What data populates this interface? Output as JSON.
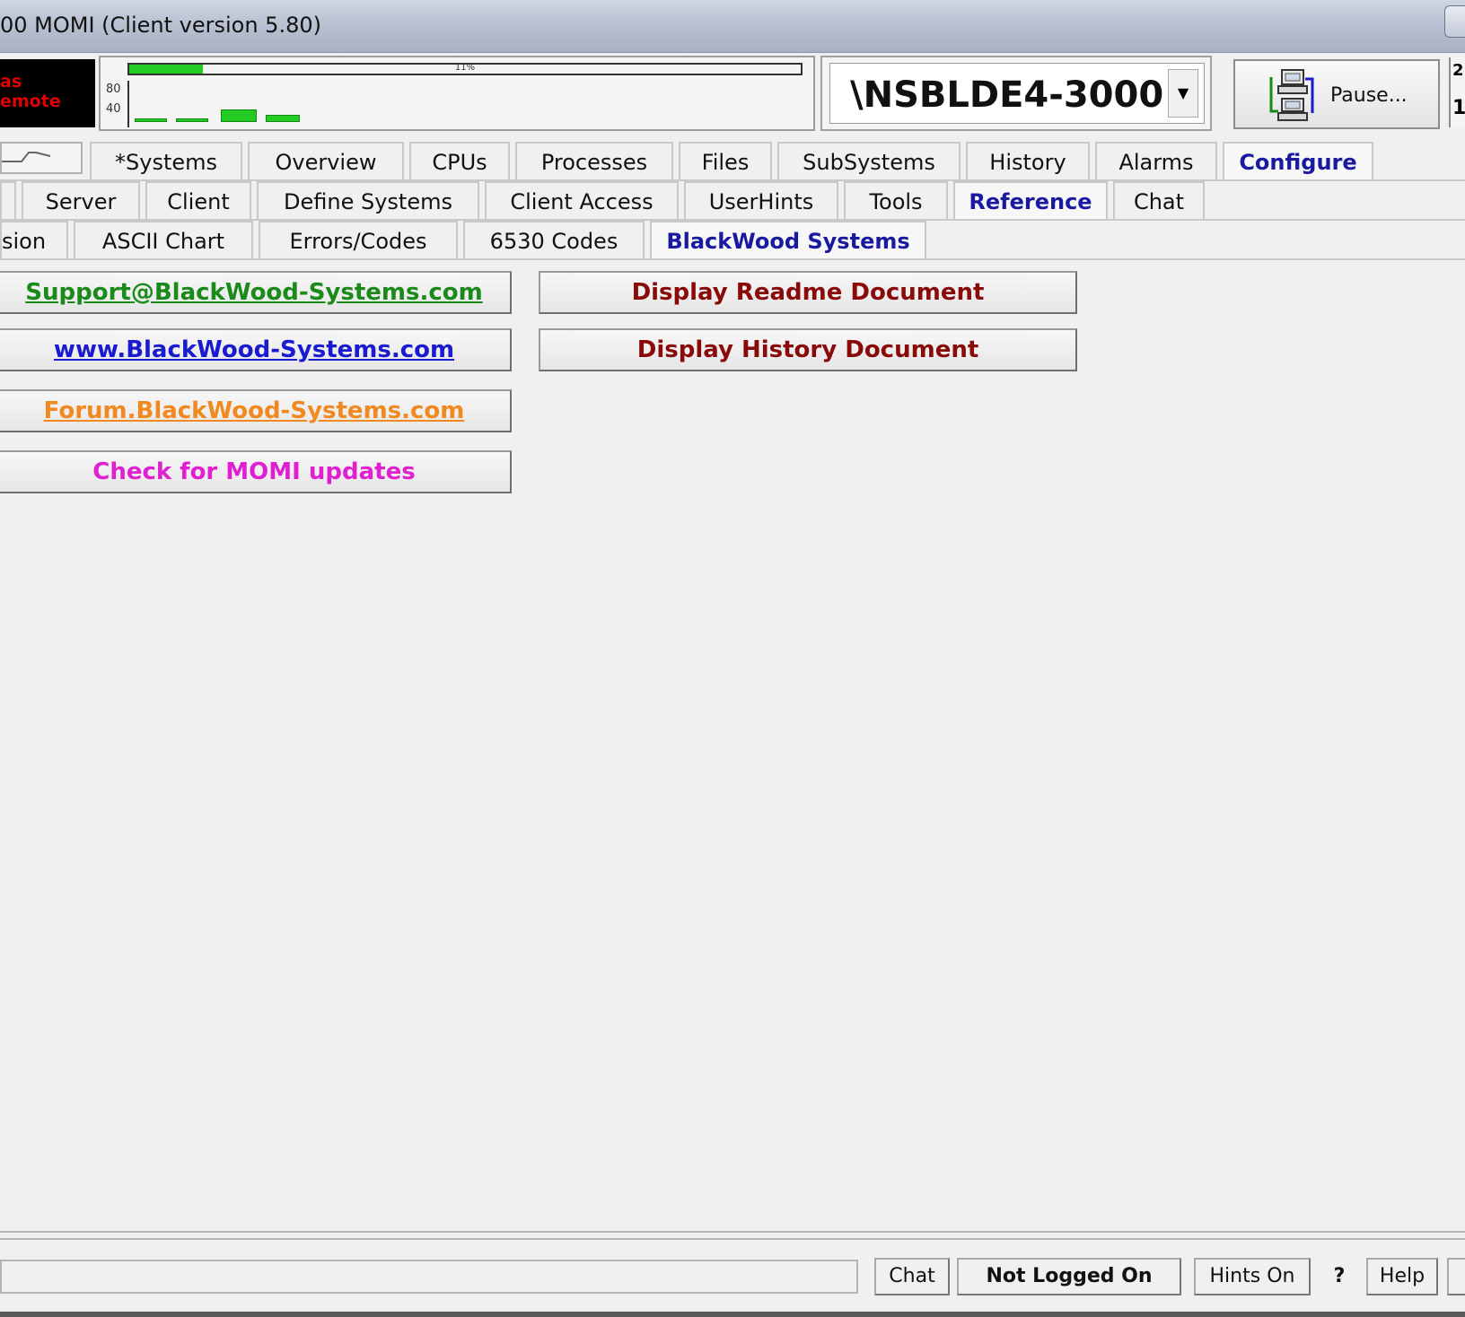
{
  "window": {
    "title": "00 MOMI (Client version 5.80)"
  },
  "toolbar": {
    "status_line1": "as",
    "status_line2": "emote",
    "graph": {
      "progress_label": "11%",
      "progress_fraction": 0.11,
      "tick_80": "80",
      "tick_40": "40"
    },
    "system_name": "\\NSBLDE4-3000",
    "pause_label": "Pause...",
    "edge_digit_top": "2",
    "edge_digit_bottom": "1"
  },
  "tabs_level1": [
    "*Systems",
    "Overview",
    "CPUs",
    "Processes",
    "Files",
    "SubSystems",
    "History",
    "Alarms",
    "Configure"
  ],
  "tabs_level1_active": "Configure",
  "tabs_level2": [
    "Server",
    "Client",
    "Define Systems",
    "Client Access",
    "UserHints",
    "Tools",
    "Reference",
    "Chat"
  ],
  "tabs_level2_active": "Reference",
  "tabs_level3": [
    "sion",
    "ASCII Chart",
    "Errors/Codes",
    "6530 Codes",
    "BlackWood Systems"
  ],
  "tabs_level3_active": "BlackWood Systems",
  "content": {
    "support_email": "Support@BlackWood-Systems.com",
    "website": "www.BlackWood-Systems.com",
    "forum": "Forum.BlackWood-Systems.com",
    "check_updates": "Check for MOMI updates",
    "readme": "Display Readme Document",
    "history_doc": "Display History Document"
  },
  "colors": {
    "support_email": "#1a8a1a",
    "website": "#1a1ad0",
    "forum": "#f08a20",
    "check_updates": "#e020d0",
    "doc_buttons": "#8a0a0a",
    "active_tab": "#1a1aa0"
  },
  "statusbar": {
    "chat": "Chat",
    "login": "Not Logged On",
    "hints": "Hints On",
    "question": "?",
    "help": "Help"
  }
}
